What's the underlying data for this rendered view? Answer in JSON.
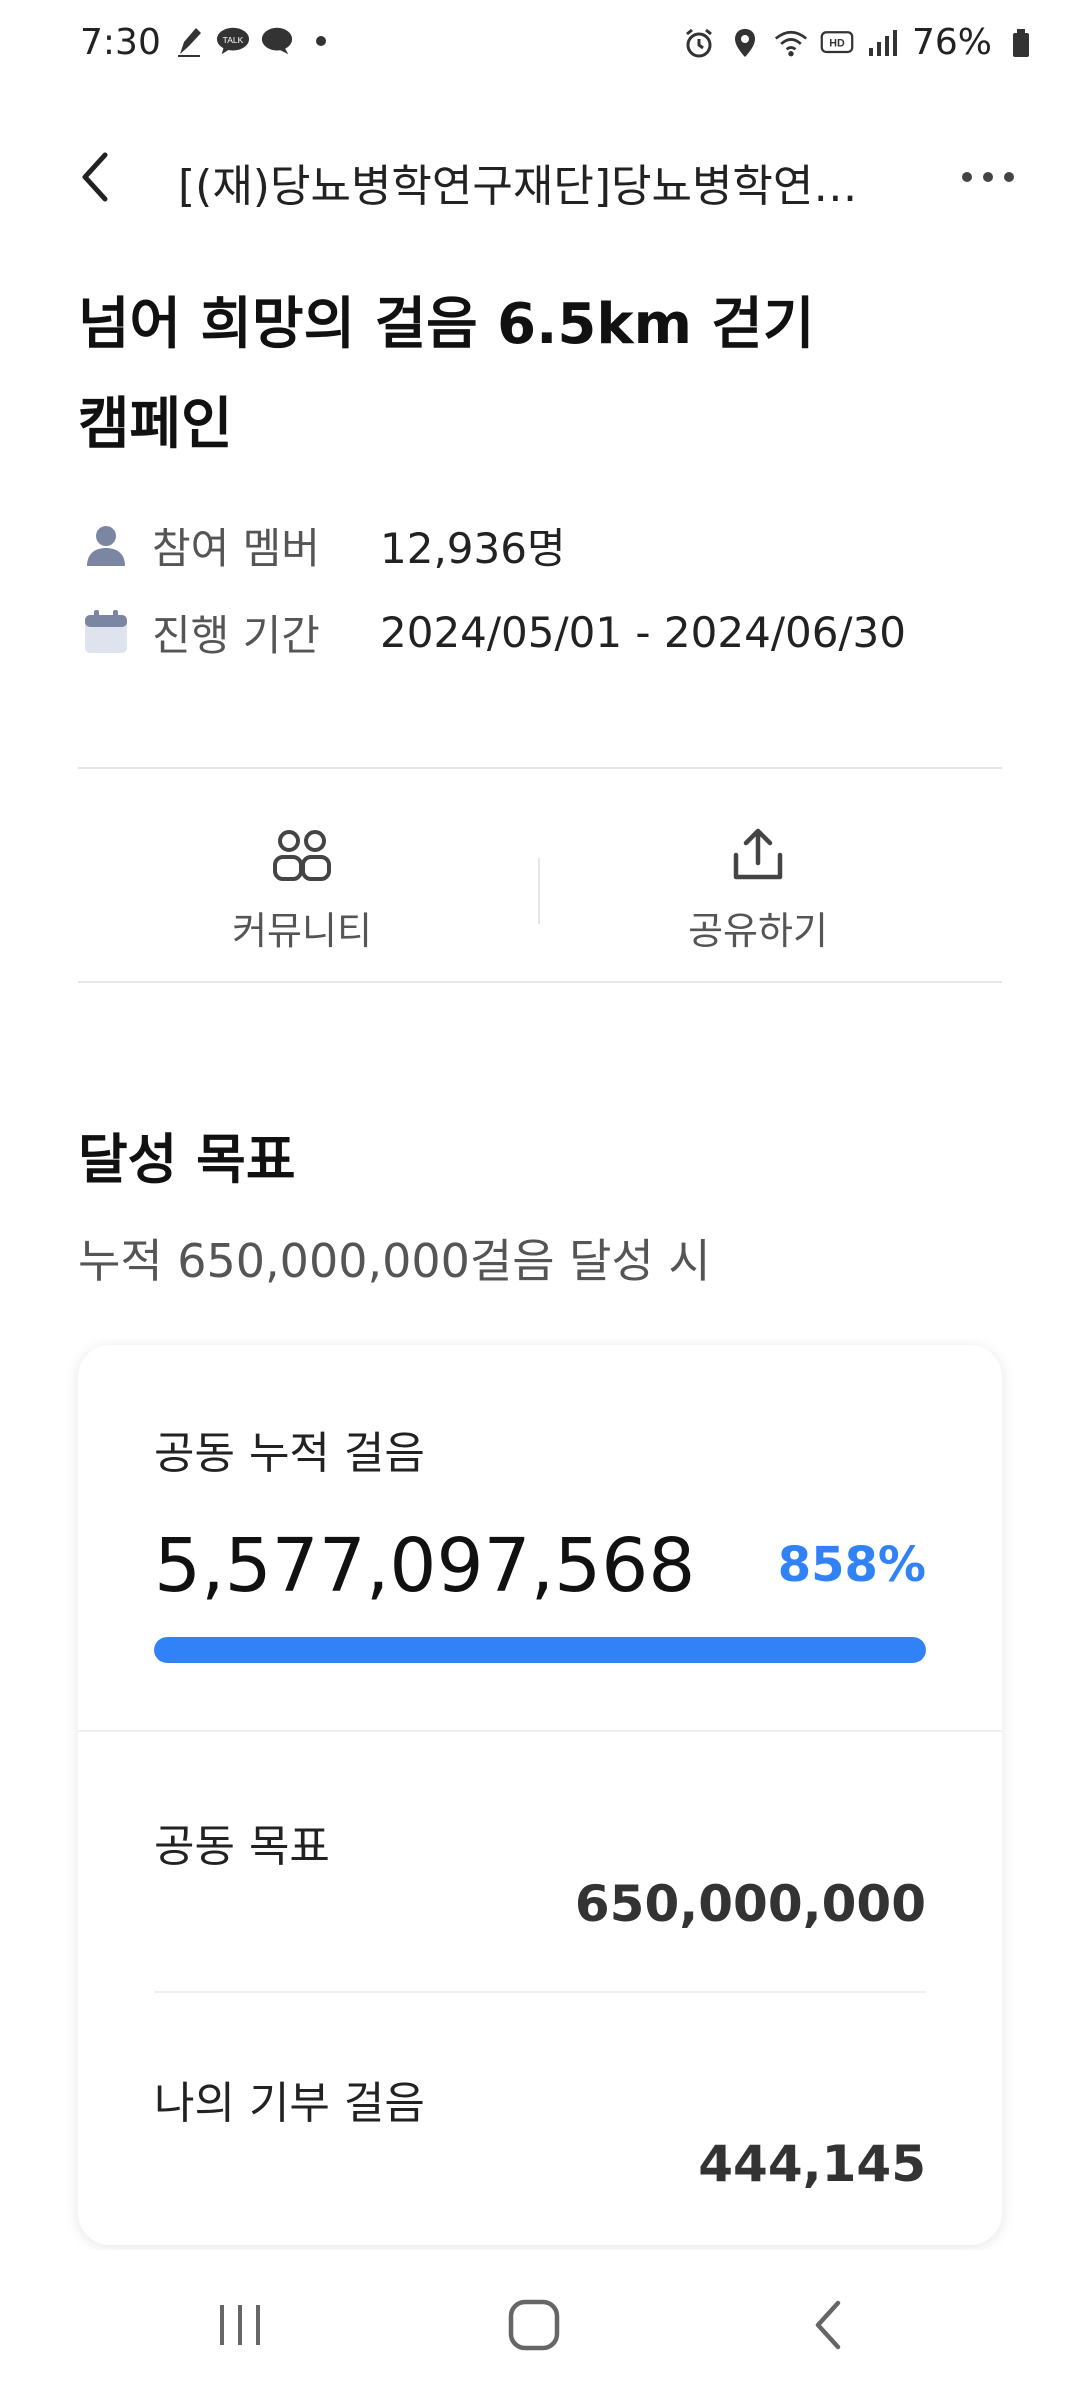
{
  "status_bar": {
    "time": "7:30",
    "battery": "76%",
    "left_icons": [
      "pen-icon",
      "talk-icon",
      "chat-icon",
      "dot-icon"
    ],
    "right_icons": [
      "alarm-icon",
      "location-icon",
      "wifi-icon",
      "hd-icon",
      "signal-icon",
      "battery-icon"
    ],
    "talk_text": "TALK",
    "hd_text": "HD"
  },
  "header": {
    "title": "[(재)당뇨병학연구재단]당뇨병학연구재단] 희망의 걸음",
    "back_icon": "back-arrow-icon",
    "more_icon": "more-dots-icon"
  },
  "campaign": {
    "title_line1": "넘어 희망의 걸음 6.5km 걷기",
    "title_line2": "캠페인",
    "members_label": "참여 멤버",
    "members_value": "12,936명",
    "period_label": "진행 기간",
    "period_value": "2024/05/01 - 2024/06/30"
  },
  "actions": {
    "community_label": "커뮤니티",
    "share_label": "공유하기"
  },
  "goal": {
    "section_title": "달성 목표",
    "subtitle": "누적 650,000,000걸음 달성 시",
    "cumulative_label": "공동 누적 걸음",
    "cumulative_value": "5,577,097,568",
    "percent_text": "858%",
    "progress_fraction": 1.0,
    "target_label": "공동 목표",
    "target_value": "650,000,000",
    "my_label": "나의 기부 걸음",
    "my_value": "444,145"
  },
  "colors": {
    "accent": "#3182f6",
    "icon_gray": "#7b86a3"
  }
}
